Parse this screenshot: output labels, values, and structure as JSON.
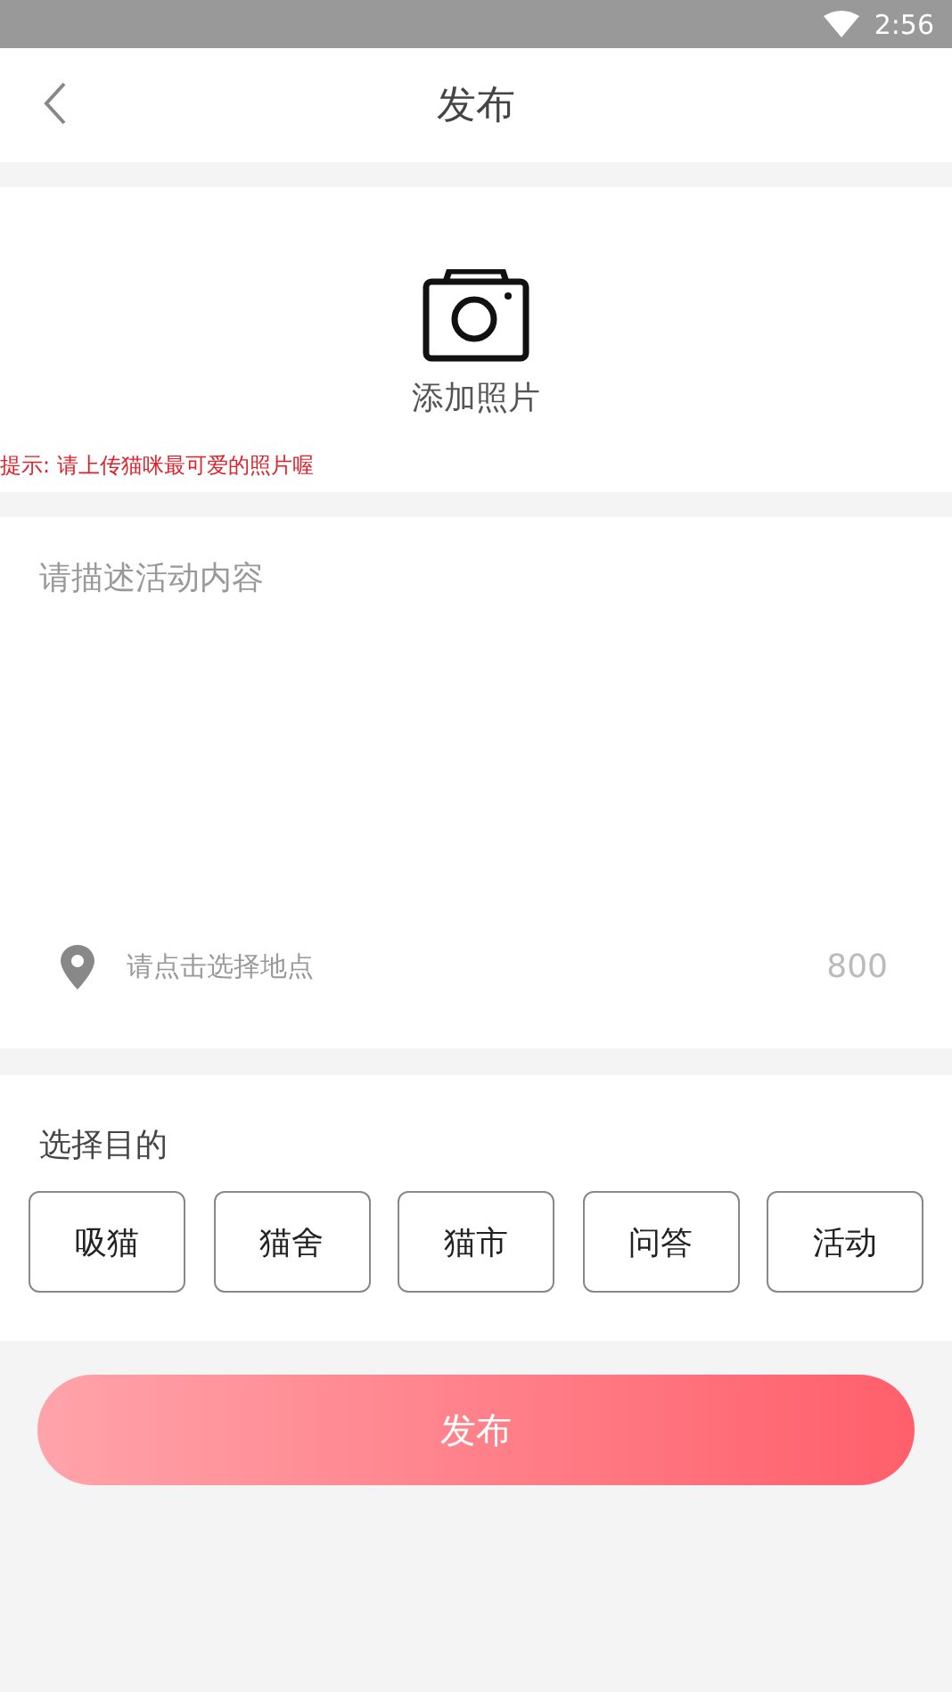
{
  "status_bar": {
    "time": "2:56"
  },
  "header": {
    "title": "发布"
  },
  "photo": {
    "label": "添加照片",
    "hint": "提示: 请上传猫咪最可爱的照片喔"
  },
  "content": {
    "placeholder": "请描述活动内容",
    "location_placeholder": "请点击选择地点",
    "char_count": "800"
  },
  "purpose": {
    "title": "选择目的",
    "options": [
      {
        "label": "吸猫",
        "selected": false
      },
      {
        "label": "猫舍",
        "selected": false
      },
      {
        "label": "猫市",
        "selected": false
      },
      {
        "label": "问答",
        "selected": false
      },
      {
        "label": "活动",
        "selected": false
      }
    ]
  },
  "submit": {
    "label": "发布"
  }
}
